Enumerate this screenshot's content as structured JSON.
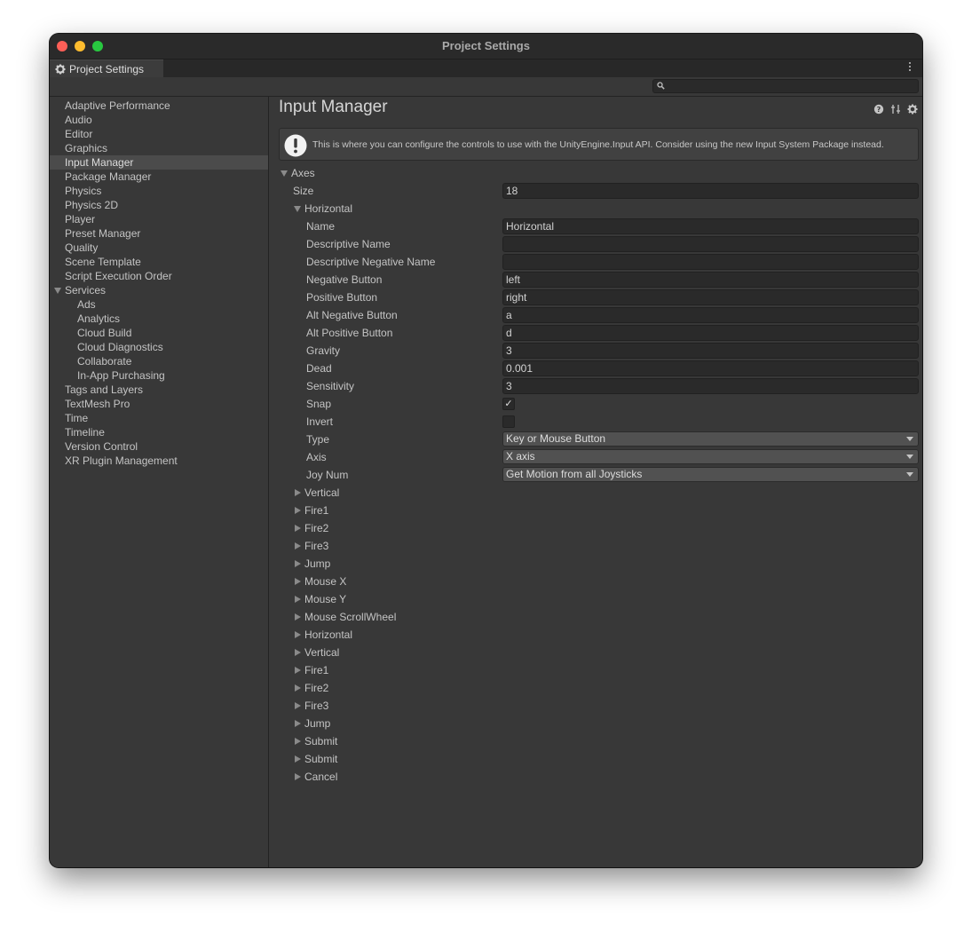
{
  "window": {
    "title": "Project Settings"
  },
  "tab": {
    "label": "Project Settings"
  },
  "sidebar": {
    "items": [
      {
        "label": "Adaptive Performance"
      },
      {
        "label": "Audio"
      },
      {
        "label": "Editor"
      },
      {
        "label": "Graphics"
      },
      {
        "label": "Input Manager",
        "selected": true
      },
      {
        "label": "Package Manager"
      },
      {
        "label": "Physics"
      },
      {
        "label": "Physics 2D"
      },
      {
        "label": "Player"
      },
      {
        "label": "Preset Manager"
      },
      {
        "label": "Quality"
      },
      {
        "label": "Scene Template"
      },
      {
        "label": "Script Execution Order"
      },
      {
        "label": "Services",
        "expanded": true
      },
      {
        "label": "Ads",
        "child": true
      },
      {
        "label": "Analytics",
        "child": true
      },
      {
        "label": "Cloud Build",
        "child": true
      },
      {
        "label": "Cloud Diagnostics",
        "child": true
      },
      {
        "label": "Collaborate",
        "child": true
      },
      {
        "label": "In-App Purchasing",
        "child": true
      },
      {
        "label": "Tags and Layers"
      },
      {
        "label": "TextMesh Pro"
      },
      {
        "label": "Time"
      },
      {
        "label": "Timeline"
      },
      {
        "label": "Version Control"
      },
      {
        "label": "XR Plugin Management"
      }
    ]
  },
  "main": {
    "title": "Input Manager",
    "info": "This is where you can configure the controls to use with the UnityEngine.Input API. Consider using the new Input System Package instead.",
    "axes_label": "Axes",
    "size_label": "Size",
    "size_value": "18",
    "expanded_axis": {
      "label": "Horizontal",
      "name": {
        "label": "Name",
        "value": "Horizontal"
      },
      "descriptive_name": {
        "label": "Descriptive Name",
        "value": ""
      },
      "descriptive_negative_name": {
        "label": "Descriptive Negative Name",
        "value": ""
      },
      "negative_button": {
        "label": "Negative Button",
        "value": "left"
      },
      "positive_button": {
        "label": "Positive Button",
        "value": "right"
      },
      "alt_negative_button": {
        "label": "Alt Negative Button",
        "value": "a"
      },
      "alt_positive_button": {
        "label": "Alt Positive Button",
        "value": "d"
      },
      "gravity": {
        "label": "Gravity",
        "value": "3"
      },
      "dead": {
        "label": "Dead",
        "value": "0.001"
      },
      "sensitivity": {
        "label": "Sensitivity",
        "value": "3"
      },
      "snap": {
        "label": "Snap",
        "checked": true,
        "mark": "✓"
      },
      "invert": {
        "label": "Invert",
        "checked": false
      },
      "type": {
        "label": "Type",
        "value": "Key or Mouse Button"
      },
      "axis": {
        "label": "Axis",
        "value": "X axis"
      },
      "joy_num": {
        "label": "Joy Num",
        "value": "Get Motion from all Joysticks"
      }
    },
    "collapsed_axes": [
      "Vertical",
      "Fire1",
      "Fire2",
      "Fire3",
      "Jump",
      "Mouse X",
      "Mouse Y",
      "Mouse ScrollWheel",
      "Horizontal",
      "Vertical",
      "Fire1",
      "Fire2",
      "Fire3",
      "Jump",
      "Submit",
      "Submit",
      "Cancel"
    ]
  }
}
